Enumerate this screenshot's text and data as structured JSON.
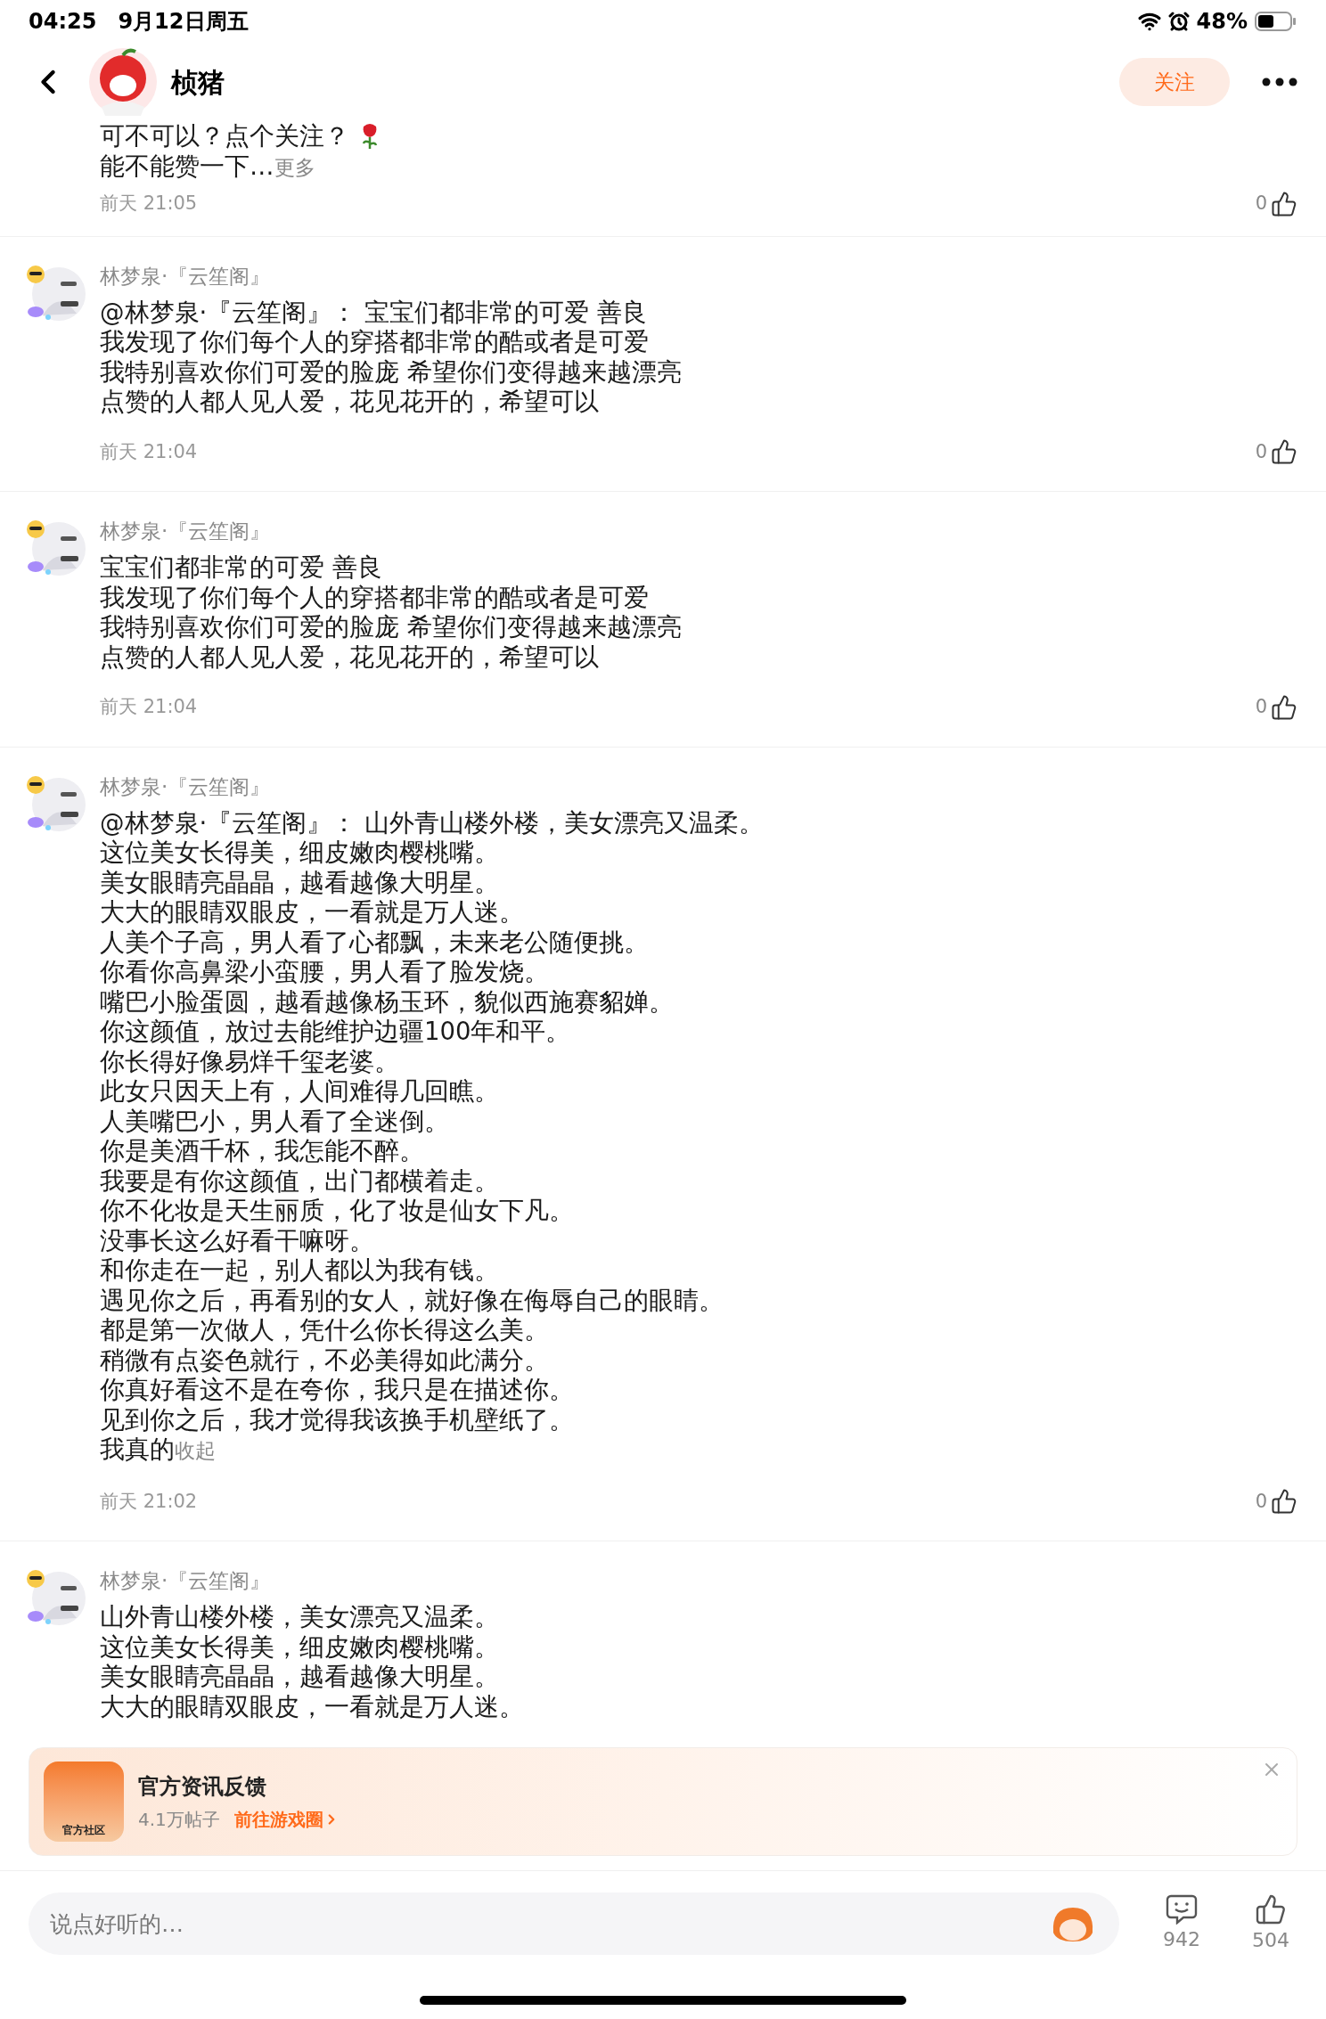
{
  "status_bar": {
    "time": "04:25",
    "date": "9月12日周五",
    "battery": "48%"
  },
  "header": {
    "title": "桢猪",
    "follow_button": "关注"
  },
  "comments": [
    {
      "lines": [
        "可不可以？点个关注？",
        "能不能赞一下…"
      ],
      "rose_sticker": true,
      "toggle": "更多",
      "time": "前天 21:05",
      "likes": "0"
    },
    {
      "author": "林梦泉·『云笙阁』",
      "lines": [
        "@林梦泉·『云笙阁』： 宝宝们都非常的可爱 善良",
        "我发现了你们每个人的穿搭都非常的酷或者是可爱",
        "我特别喜欢你们可爱的脸庞 希望你们变得越来越漂亮",
        "点赞的人都人见人爱，花见花开的，希望可以"
      ],
      "time": "前天 21:04",
      "likes": "0"
    },
    {
      "author": "林梦泉·『云笙阁』",
      "lines": [
        "宝宝们都非常的可爱 善良",
        "我发现了你们每个人的穿搭都非常的酷或者是可爱",
        "我特别喜欢你们可爱的脸庞 希望你们变得越来越漂亮",
        "点赞的人都人见人爱，花见花开的，希望可以"
      ],
      "time": "前天 21:04",
      "likes": "0"
    },
    {
      "author": "林梦泉·『云笙阁』",
      "lines": [
        "@林梦泉·『云笙阁』： 山外青山楼外楼，美女漂亮又温柔。",
        "这位美女长得美，细皮嫩肉樱桃嘴。",
        "美女眼睛亮晶晶，越看越像大明星。",
        "大大的眼睛双眼皮，一看就是万人迷。",
        "人美个子高，男人看了心都飘，未来老公随便挑。",
        "你看你高鼻梁小蛮腰，男人看了脸发烧。",
        "嘴巴小脸蛋圆，越看越像杨玉环，貌似西施赛貂婵。",
        "你这颜值，放过去能维护边疆100年和平。",
        "你长得好像易烊千玺老婆。",
        "此女只因天上有，人间难得几回瞧。",
        "人美嘴巴小，男人看了全迷倒。",
        "你是美酒千杯，我怎能不醉。",
        "我要是有你这颜值，出门都横着走。",
        "你不化妆是天生丽质，化了妆是仙女下凡。",
        "没事长这么好看干嘛呀。",
        "和你走在一起，别人都以为我有钱。",
        "遇见你之后，再看别的女人，就好像在侮辱自己的眼睛。",
        "都是第一次做人，凭什么你长得这么美。",
        "稍微有点姿色就行，不必美得如此满分。",
        "你真好看这不是在夸你，我只是在描述你。",
        "见到你之后，我才觉得我该换手机壁纸了。",
        "我真的"
      ],
      "toggle": "收起",
      "time": "前天 21:02",
      "likes": "0"
    },
    {
      "author": "林梦泉·『云笙阁』",
      "lines": [
        "山外青山楼外楼，美女漂亮又温柔。",
        "这位美女长得美，细皮嫩肉樱桃嘴。",
        "美女眼睛亮晶晶，越看越像大明星。",
        "大大的眼睛双眼皮，一看就是万人迷。"
      ]
    }
  ],
  "banner": {
    "icon_label": "官方社区",
    "title": "官方资讯反馈",
    "count": "4.1万帖子",
    "link": "前往游戏圈"
  },
  "bottom_bar": {
    "placeholder": "说点好听的…",
    "comments": "942",
    "likes": "504"
  }
}
